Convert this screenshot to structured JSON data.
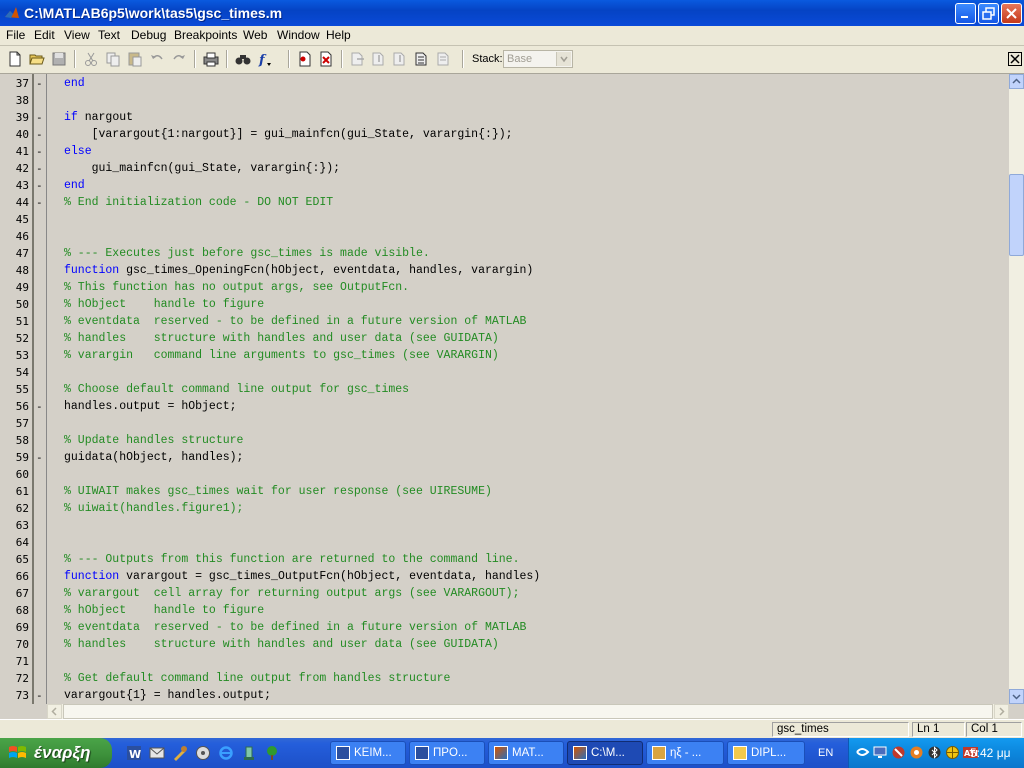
{
  "window": {
    "title": "C:\\MATLAB6p5\\work\\tas5\\gsc_times.m"
  },
  "menu": [
    "File",
    "Edit",
    "View",
    "Text",
    "Debug",
    "Breakpoints",
    "Web",
    "Window",
    "Help"
  ],
  "toolbar": {
    "stack_label": "Stack:",
    "stack_value": "Base",
    "icons": [
      "new-file-icon",
      "open-icon",
      "save-icon",
      "cut-icon",
      "copy-icon",
      "paste-icon",
      "undo-icon",
      "redo-icon",
      "print-icon",
      "find-icon",
      "function-icon",
      "set-breakpoint-icon",
      "clear-breakpoints-icon",
      "step-icon",
      "step-in-icon",
      "step-out-icon",
      "continue-icon",
      "exit-debug-icon"
    ]
  },
  "editor": {
    "lines": [
      {
        "n": "37",
        "dash": true,
        "segs": [
          {
            "t": "end",
            "c": "kw"
          }
        ]
      },
      {
        "n": "38",
        "dash": false,
        "segs": []
      },
      {
        "n": "39",
        "dash": true,
        "segs": [
          {
            "t": "if",
            "c": "kw"
          },
          {
            "t": " nargout",
            "c": ""
          }
        ]
      },
      {
        "n": "40",
        "dash": true,
        "segs": [
          {
            "t": "    [varargout{1:nargout}] = gui_mainfcn(gui_State, varargin{:});",
            "c": ""
          }
        ]
      },
      {
        "n": "41",
        "dash": true,
        "segs": [
          {
            "t": "else",
            "c": "kw"
          }
        ]
      },
      {
        "n": "42",
        "dash": true,
        "segs": [
          {
            "t": "    gui_mainfcn(gui_State, varargin{:});",
            "c": ""
          }
        ]
      },
      {
        "n": "43",
        "dash": true,
        "segs": [
          {
            "t": "end",
            "c": "kw"
          }
        ]
      },
      {
        "n": "44",
        "dash": true,
        "segs": [
          {
            "t": "% End initialization code - DO NOT EDIT",
            "c": "cm"
          }
        ]
      },
      {
        "n": "45",
        "dash": false,
        "segs": []
      },
      {
        "n": "46",
        "dash": false,
        "segs": []
      },
      {
        "n": "47",
        "dash": false,
        "segs": [
          {
            "t": "% --- Executes just before gsc_times is made visible.",
            "c": "cm"
          }
        ]
      },
      {
        "n": "48",
        "dash": false,
        "segs": [
          {
            "t": "function",
            "c": "kw"
          },
          {
            "t": " gsc_times_OpeningFcn(hObject, eventdata, handles, varargin)",
            "c": ""
          }
        ]
      },
      {
        "n": "49",
        "dash": false,
        "segs": [
          {
            "t": "% This function has no output args, see OutputFcn.",
            "c": "cm"
          }
        ]
      },
      {
        "n": "50",
        "dash": false,
        "segs": [
          {
            "t": "% hObject    handle to figure",
            "c": "cm"
          }
        ]
      },
      {
        "n": "51",
        "dash": false,
        "segs": [
          {
            "t": "% eventdata  reserved - to be defined in a future version of MATLAB",
            "c": "cm"
          }
        ]
      },
      {
        "n": "52",
        "dash": false,
        "segs": [
          {
            "t": "% handles    structure with handles and user data (see GUIDATA)",
            "c": "cm"
          }
        ]
      },
      {
        "n": "53",
        "dash": false,
        "segs": [
          {
            "t": "% varargin   command line arguments to gsc_times (see VARARGIN)",
            "c": "cm"
          }
        ]
      },
      {
        "n": "54",
        "dash": false,
        "segs": []
      },
      {
        "n": "55",
        "dash": false,
        "segs": [
          {
            "t": "% Choose default command line output for gsc_times",
            "c": "cm"
          }
        ]
      },
      {
        "n": "56",
        "dash": true,
        "segs": [
          {
            "t": "handles.output = hObject;",
            "c": ""
          }
        ]
      },
      {
        "n": "57",
        "dash": false,
        "segs": []
      },
      {
        "n": "58",
        "dash": false,
        "segs": [
          {
            "t": "% Update handles structure",
            "c": "cm"
          }
        ]
      },
      {
        "n": "59",
        "dash": true,
        "segs": [
          {
            "t": "guidata(hObject, handles);",
            "c": ""
          }
        ]
      },
      {
        "n": "60",
        "dash": false,
        "segs": []
      },
      {
        "n": "61",
        "dash": false,
        "segs": [
          {
            "t": "% UIWAIT makes gsc_times wait for user response (see UIRESUME)",
            "c": "cm"
          }
        ]
      },
      {
        "n": "62",
        "dash": false,
        "segs": [
          {
            "t": "% uiwait(handles.figure1);",
            "c": "cm"
          }
        ]
      },
      {
        "n": "63",
        "dash": false,
        "segs": []
      },
      {
        "n": "64",
        "dash": false,
        "segs": []
      },
      {
        "n": "65",
        "dash": false,
        "segs": [
          {
            "t": "% --- Outputs from this function are returned to the command line.",
            "c": "cm"
          }
        ]
      },
      {
        "n": "66",
        "dash": false,
        "segs": [
          {
            "t": "function",
            "c": "kw"
          },
          {
            "t": " varargout = gsc_times_OutputFcn(hObject, eventdata, handles)",
            "c": ""
          }
        ]
      },
      {
        "n": "67",
        "dash": false,
        "segs": [
          {
            "t": "% varargout  cell array for returning output args (see VARARGOUT);",
            "c": "cm"
          }
        ]
      },
      {
        "n": "68",
        "dash": false,
        "segs": [
          {
            "t": "% hObject    handle to figure",
            "c": "cm"
          }
        ]
      },
      {
        "n": "69",
        "dash": false,
        "segs": [
          {
            "t": "% eventdata  reserved - to be defined in a future version of MATLAB",
            "c": "cm"
          }
        ]
      },
      {
        "n": "70",
        "dash": false,
        "segs": [
          {
            "t": "% handles    structure with handles and user data (see GUIDATA)",
            "c": "cm"
          }
        ]
      },
      {
        "n": "71",
        "dash": false,
        "segs": []
      },
      {
        "n": "72",
        "dash": false,
        "segs": [
          {
            "t": "% Get default command line output from handles structure",
            "c": "cm"
          }
        ]
      },
      {
        "n": "73",
        "dash": true,
        "segs": [
          {
            "t": "varargout{1} = handles.output;",
            "c": ""
          }
        ]
      }
    ]
  },
  "status": {
    "function_name": "gsc_times",
    "line": "Ln 1",
    "col": "Col 1"
  },
  "taskbar": {
    "start_label": "έναρξη",
    "tasks": [
      {
        "label": "ΚΕΙΜ...",
        "icon": "word-icon",
        "active": false
      },
      {
        "label": "ΠΡΟ...",
        "icon": "word-icon",
        "active": false
      },
      {
        "label": "MAT...",
        "icon": "matlab-icon",
        "active": false
      },
      {
        "label": "C:\\M...",
        "icon": "matlab-icon",
        "active": true
      },
      {
        "label": "ηξ - ...",
        "icon": "paint-icon",
        "active": false
      },
      {
        "label": "DIPL...",
        "icon": "folder-icon",
        "active": false
      }
    ],
    "language": "EN",
    "clock": "5:42 μμ"
  },
  "colors": {
    "keyword": "#0000ff",
    "comment": "#228b22",
    "editor_bg": "#d4d0c8",
    "titlebar": "#0a4ad8"
  }
}
